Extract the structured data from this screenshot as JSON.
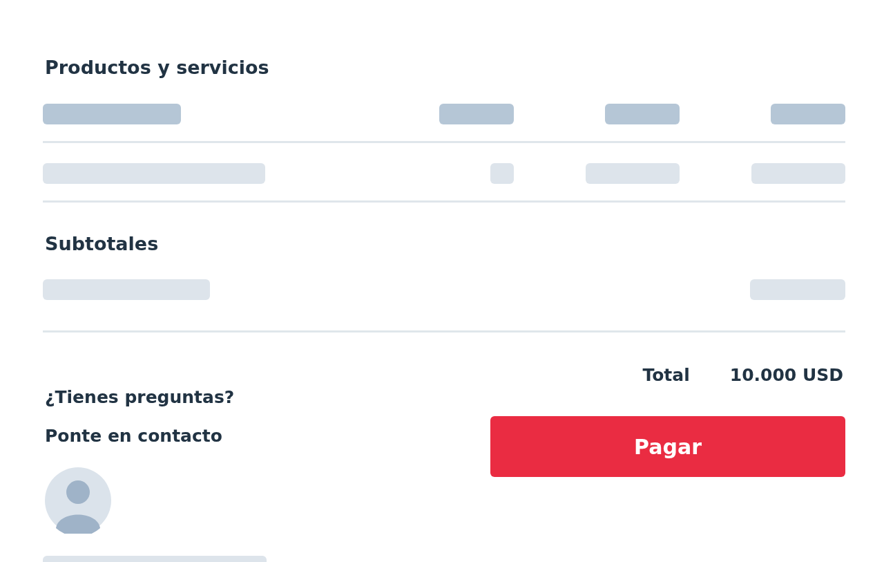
{
  "products": {
    "title": "Productos y servicios"
  },
  "subtotals": {
    "title": "Subtotales"
  },
  "total": {
    "label": "Total",
    "value": "10.000 USD"
  },
  "pay_button": {
    "label": "Pagar"
  },
  "contact": {
    "question": "¿Tienes preguntas?",
    "prompt": "Ponte en contacto"
  }
}
